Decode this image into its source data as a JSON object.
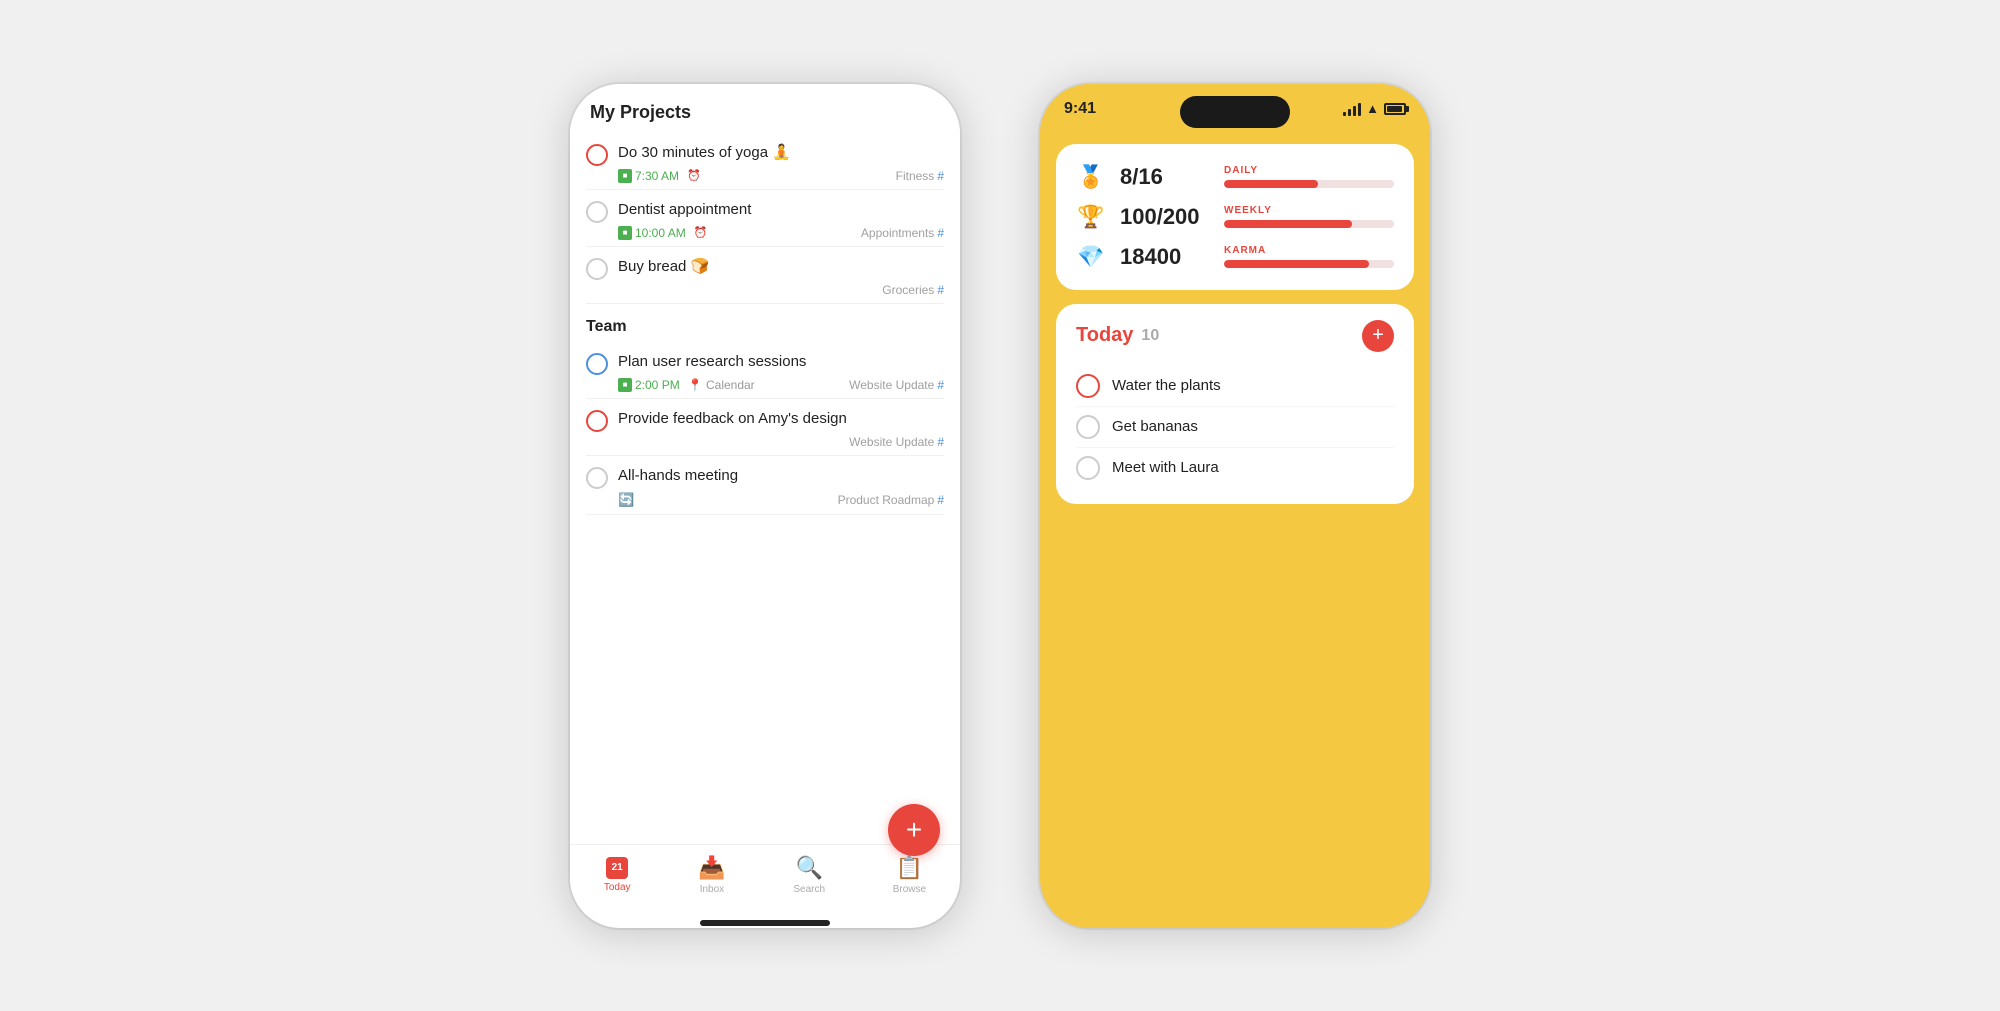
{
  "leftPhone": {
    "header": "My Projects",
    "tasks": [
      {
        "id": "yoga",
        "title": "Do 30 minutes of yoga 🧘",
        "checkboxStyle": "red",
        "time": "7:30 AM",
        "hasAlarm": true,
        "tag": "Fitness",
        "recurring": false
      },
      {
        "id": "dentist",
        "title": "Dentist appointment",
        "checkboxStyle": "default",
        "time": "10:00 AM",
        "hasAlarm": true,
        "tag": "Appointments",
        "recurring": false
      },
      {
        "id": "bread",
        "title": "Buy bread 🍞",
        "checkboxStyle": "default",
        "time": null,
        "hasAlarm": false,
        "tag": "Groceries",
        "recurring": false
      }
    ],
    "teamSection": {
      "label": "Team",
      "tasks": [
        {
          "id": "user-research",
          "title": "Plan user research sessions",
          "checkboxStyle": "blue",
          "time": "2:00 PM",
          "hasLocation": true,
          "location": "Calendar",
          "tag": "Website Update",
          "recurring": false
        },
        {
          "id": "amy-feedback",
          "title": "Provide feedback on Amy's design",
          "checkboxStyle": "red",
          "time": null,
          "hasLocation": false,
          "tag": "Website Update",
          "recurring": false
        },
        {
          "id": "all-hands",
          "title": "All-hands meeting",
          "checkboxStyle": "default",
          "time": null,
          "hasLocation": false,
          "tag": "Product Roadmap",
          "recurring": true
        }
      ]
    },
    "nav": {
      "items": [
        {
          "id": "today",
          "label": "Today",
          "active": true,
          "iconType": "calendar",
          "calDay": "21"
        },
        {
          "id": "inbox",
          "label": "Inbox",
          "active": false,
          "iconType": "inbox"
        },
        {
          "id": "search",
          "label": "Search",
          "active": false,
          "iconType": "search"
        },
        {
          "id": "browse",
          "label": "Browse",
          "active": false,
          "iconType": "browse"
        }
      ]
    }
  },
  "rightPhone": {
    "statusBar": {
      "time": "9:41",
      "signal": 4,
      "wifi": true,
      "battery": 100
    },
    "stats": {
      "daily": {
        "value": "8/16",
        "label": "DAILY",
        "fillPercent": 55
      },
      "weekly": {
        "value": "100/200",
        "label": "WEEKLY",
        "fillPercent": 75
      },
      "karma": {
        "value": "18400",
        "label": "KARMA",
        "fillPercent": 85
      }
    },
    "today": {
      "title": "Today",
      "count": 10,
      "tasks": [
        {
          "id": "water",
          "text": "Water the plants",
          "checkboxStyle": "red"
        },
        {
          "id": "bananas",
          "text": "Get bananas",
          "checkboxStyle": "default"
        },
        {
          "id": "laura",
          "text": "Meet with Laura",
          "checkboxStyle": "default"
        }
      ]
    }
  }
}
